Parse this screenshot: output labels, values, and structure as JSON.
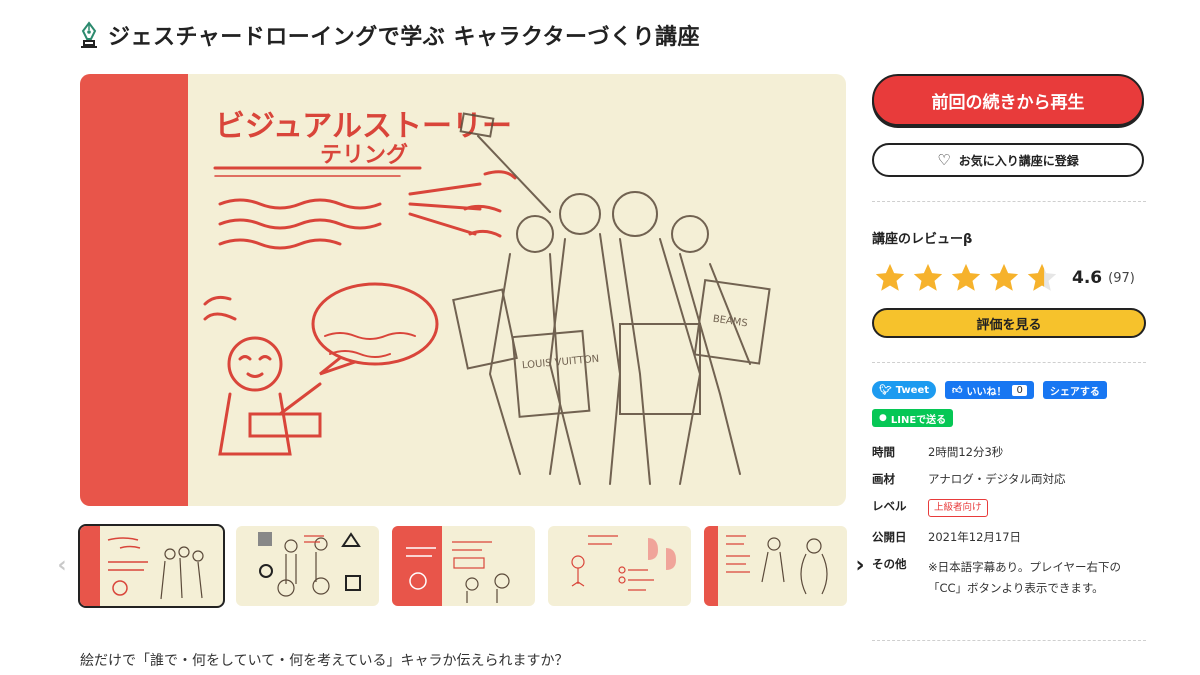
{
  "course": {
    "title": "ジェスチャードローイングで学ぶ キャラクターづくり講座",
    "description": "絵だけで「誰で・何をしていて・何を考えている」キャラか伝えられますか？"
  },
  "main_image": {
    "heading_line1": "ビジュアルストーリー",
    "heading_line2": "テリング",
    "bag_label_1": "LOUIS VUITTON",
    "bag_label_2": "BEAMS"
  },
  "thumbnails": [
    {
      "active": true
    },
    {
      "active": false
    },
    {
      "active": false
    },
    {
      "active": false
    },
    {
      "active": false
    }
  ],
  "thumb_nav": {
    "prev_icon": "chevron-left-icon",
    "next_icon": "chevron-right-icon"
  },
  "sidebar": {
    "play_button": "前回の続きから再生",
    "favorite_button": "お気に入り講座に登録",
    "review_title": "講座のレビューβ",
    "rating": 4.6,
    "rating_value": "4.6",
    "rating_count": "(97)",
    "review_button": "評価を見る",
    "share": {
      "tweet": "Tweet",
      "like": "いいね！",
      "like_count": "0",
      "share": "シェアする",
      "line": "LINEで送る"
    },
    "info": {
      "time_label": "時間",
      "time_value": "2時間12分3秒",
      "medium_label": "画材",
      "medium_value": "アナログ・デジタル両対応",
      "level_label": "レベル",
      "level_value": "上級者向け",
      "published_label": "公開日",
      "published_value": "2021年12月17日",
      "other_label": "その他",
      "other_value": "※日本語字幕あり。プレイヤー右下の「CC」ボタンより表示できます。"
    }
  },
  "colors": {
    "accent_red": "#e83b3b",
    "band_red": "#e8554a",
    "paper": "#f4efd6",
    "star": "#f6b22c",
    "review_button": "#f6c22c",
    "twitter": "#1d9bf0",
    "facebook": "#1877f2",
    "line": "#06c755"
  }
}
